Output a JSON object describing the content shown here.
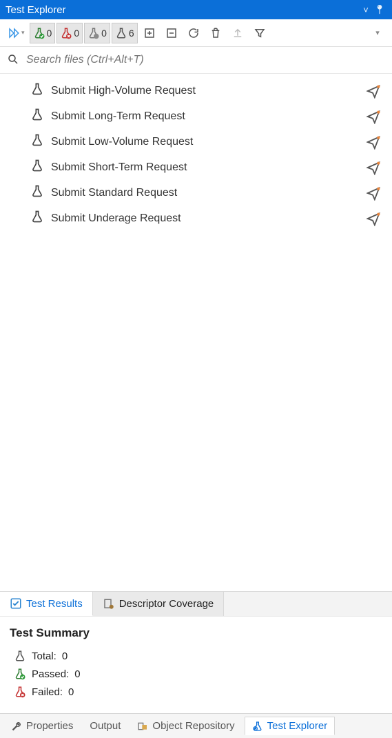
{
  "title_bar": {
    "title": "Test Explorer"
  },
  "toolbar": {
    "passed_count": "0",
    "failed_count": "0",
    "not_run_count": "0",
    "total_count": "6"
  },
  "search": {
    "placeholder": "Search files (Ctrl+Alt+T)"
  },
  "tests": [
    {
      "name": "Submit High-Volume Request"
    },
    {
      "name": "Submit Long-Term Request"
    },
    {
      "name": "Submit Low-Volume Request"
    },
    {
      "name": "Submit Short-Term Request"
    },
    {
      "name": "Submit Standard Request"
    },
    {
      "name": "Submit Underage Request"
    }
  ],
  "result_tabs": {
    "test_results": "Test Results",
    "descriptor_coverage": "Descriptor Coverage"
  },
  "summary": {
    "heading": "Test Summary",
    "total_prefix": "Total:",
    "total_value": "0",
    "passed_prefix": "Passed:",
    "passed_value": "0",
    "failed_prefix": "Failed:",
    "failed_value": "0"
  },
  "panel_tabs": {
    "properties": "Properties",
    "output": "Output",
    "object_repository": "Object Repository",
    "test_explorer": "Test Explorer"
  }
}
